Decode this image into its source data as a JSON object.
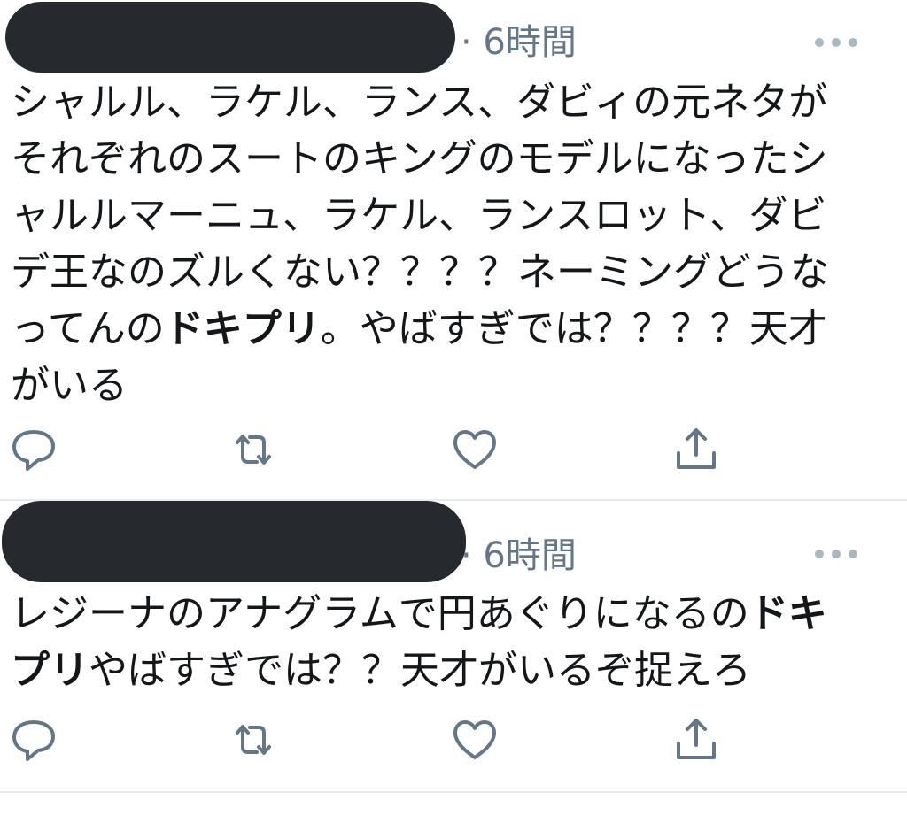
{
  "tweets": [
    {
      "time": "· 6時間",
      "icons": {
        "more": "more-dots-icon",
        "reply": "reply-icon",
        "retweet": "retweet-icon",
        "like": "heart-icon",
        "share": "share-icon"
      },
      "lines": [
        {
          "pre": "シャルル、ラケル、ランス、ダビィの元ネタが",
          "bold": "",
          "post": ""
        },
        {
          "pre": "それぞれのスートのキングのモデルになったシ",
          "bold": "",
          "post": ""
        },
        {
          "pre": "ャルルマーニュ、ラケル、ランスロット、ダビ",
          "bold": "",
          "post": ""
        },
        {
          "pre": "デ王なのズルくない？？？？ネーミングどうな",
          "bold": "",
          "post": ""
        },
        {
          "pre": "ってんの",
          "bold": "ドキプリ",
          "post": "。やばすぎでは？？？？天才"
        },
        {
          "pre": "がいる",
          "bold": "",
          "post": ""
        }
      ]
    },
    {
      "time": "· 6時間",
      "icons": {
        "more": "more-dots-icon",
        "reply": "reply-icon",
        "retweet": "retweet-icon",
        "like": "heart-icon",
        "share": "share-icon"
      },
      "lines": [
        {
          "pre": "レジーナのアナグラムで円あぐりになるの",
          "bold": "ドキ",
          "post": ""
        },
        {
          "pre": "",
          "bold": "プリ",
          "post": "やばすぎでは？？天才がいるぞ捉えろ"
        }
      ]
    }
  ],
  "colors": {
    "text": "#14171a",
    "meta": "#657786",
    "icon": "#657786",
    "divider": "#e6ecf0",
    "redaction": "#262a2e"
  }
}
